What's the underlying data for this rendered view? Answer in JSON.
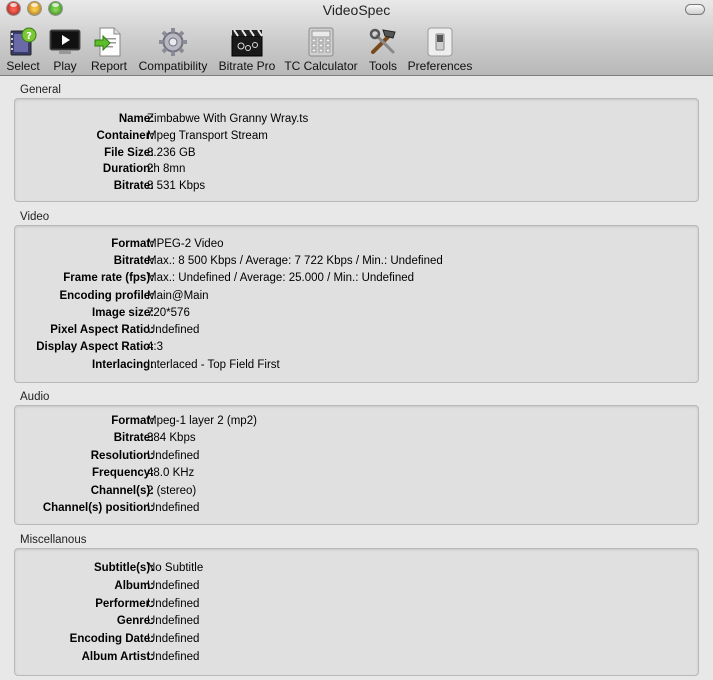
{
  "window": {
    "title": "VideoSpec"
  },
  "toolbar": {
    "items": [
      {
        "label": "Select",
        "icon": "select-icon"
      },
      {
        "label": "Play",
        "icon": "play-icon"
      },
      {
        "label": "Report",
        "icon": "report-icon"
      },
      {
        "label": "Compatibility",
        "icon": "gear-icon"
      },
      {
        "label": "Bitrate Pro",
        "icon": "clapperboard-icon"
      },
      {
        "label": "TC Calculator",
        "icon": "calculator-icon"
      },
      {
        "label": "Tools",
        "icon": "tools-icon"
      },
      {
        "label": "Preferences",
        "icon": "switch-icon"
      }
    ]
  },
  "sections": {
    "general": {
      "title": "General",
      "rows": [
        {
          "label": "Name:",
          "value": "Zimbabwe With Granny Wray.ts"
        },
        {
          "label": "Container:",
          "value": "Mpeg Transport Stream"
        },
        {
          "label": "File Size:",
          "value": "8.236 GB"
        },
        {
          "label": "Duration:",
          "value": "2h 8mn"
        },
        {
          "label": "Bitrate:",
          "value": "8 531 Kbps"
        }
      ]
    },
    "video": {
      "title": "Video",
      "rows": [
        {
          "label": "Format:",
          "value": "MPEG-2 Video"
        },
        {
          "label": "Bitrate:",
          "value": "Max.: 8 500 Kbps / Average: 7 722 Kbps / Min.: Undefined"
        },
        {
          "label": "Frame rate (fps):",
          "value": "Max.: Undefined / Average: 25.000 / Min.: Undefined"
        },
        {
          "label": "Encoding profile:",
          "value": "Main@Main"
        },
        {
          "label": "Image size:",
          "value": "720*576"
        },
        {
          "label": "Pixel Aspect Ratio:",
          "value": "Undefined"
        },
        {
          "label": "Display Aspect Ratio:",
          "value": "4:3"
        },
        {
          "label": "Interlacing:",
          "value": "Interlaced - Top Field First"
        }
      ]
    },
    "audio": {
      "title": "Audio",
      "rows": [
        {
          "label": "Format:",
          "value": "Mpeg-1 layer 2 (mp2)"
        },
        {
          "label": "Bitrate:",
          "value": "384 Kbps"
        },
        {
          "label": "Resolution:",
          "value": "Undefined"
        },
        {
          "label": "Frequency:",
          "value": "48.0 KHz"
        },
        {
          "label": "Channel(s):",
          "value": "2 (stereo)"
        },
        {
          "label": "Channel(s) position:",
          "value": "Undefined"
        }
      ]
    },
    "misc": {
      "title": "Miscellanous",
      "rows": [
        {
          "label": "Subtitle(s):",
          "value": "No Subtitle"
        },
        {
          "label": "Album:",
          "value": "Undefined"
        },
        {
          "label": "Performer:",
          "value": "Undefined"
        },
        {
          "label": "Genre:",
          "value": "Undefined"
        },
        {
          "label": "Encoding Date:",
          "value": "Undefined"
        },
        {
          "label": "Album Artist:",
          "value": "Undefined"
        }
      ]
    }
  }
}
